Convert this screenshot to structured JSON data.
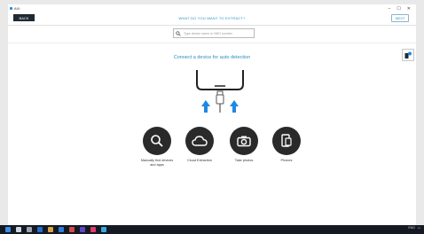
{
  "window": {
    "title": "AXI",
    "controls": [
      "–",
      "☐",
      "✕"
    ]
  },
  "toolbar": {
    "back_label": "BACK",
    "prompt": "WHAT DO YOU WANT TO EXTRACT?",
    "next_label": "NEXT"
  },
  "search": {
    "placeholder": "Type device name or IMEI number"
  },
  "main": {
    "connect_title": "Connect a device for auto detection"
  },
  "actions": [
    {
      "label": "Manually find devices and apps",
      "icon": "search-icon"
    },
    {
      "label": "Cloud Extraction",
      "icon": "cloud-icon"
    },
    {
      "label": "Take photos",
      "icon": "camera-icon"
    },
    {
      "label": "Phones",
      "icon": "phone-icon"
    }
  ],
  "colors": {
    "accent": "#2a8fbf",
    "dark": "#1f2a33",
    "arrow": "#1e88e5"
  },
  "taskbar": {
    "tray_text": "ENG"
  }
}
